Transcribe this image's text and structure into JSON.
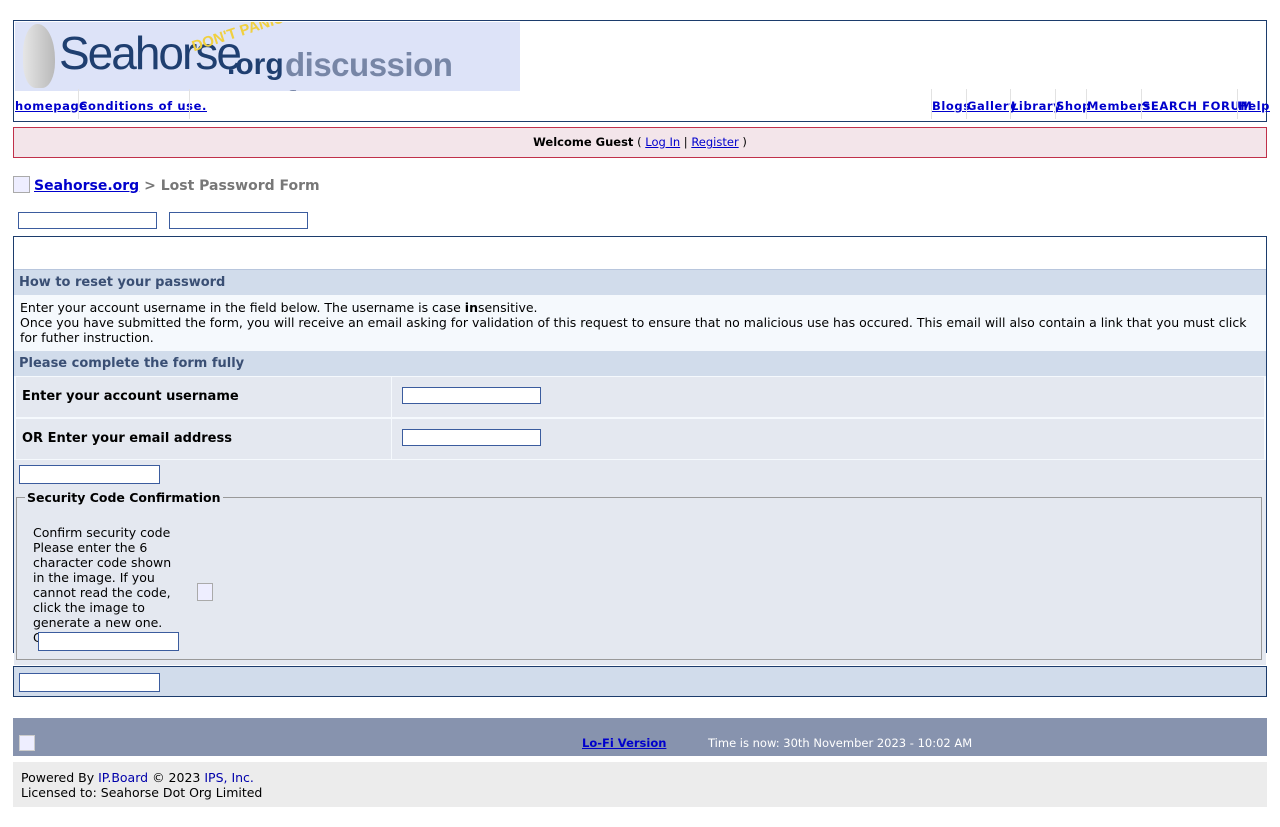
{
  "header": {
    "logo": {
      "site": "Seahorse",
      "tagline": "DON'T PANIC!",
      "tld": ".org",
      "subtitle": "discussion forums"
    },
    "nav_left": [
      "homepage",
      "Conditions of use."
    ],
    "nav_right": [
      "Blogs",
      "Gallery",
      "Library",
      "Shop",
      "Members",
      "SEARCH FORUM",
      "Help"
    ]
  },
  "userbar": {
    "welcome": "Welcome Guest",
    "open": "(",
    "login": "Log In",
    "sep": "|",
    "register": "Register",
    "close": ")"
  },
  "breadcrumb": {
    "home": "Seahorse.org",
    "sep": ">",
    "current": "Lost Password Form"
  },
  "form": {
    "section_title": "How to reset your password",
    "desc_line1_a": "Enter your account username in the field below. The username is case ",
    "desc_line1_bold": "in",
    "desc_line1_b": "sensitive.",
    "desc_line2": "Once you have submitted the form, you will receive an email asking for validation of this request to ensure that no malicious use has occured. This email will also contain a link that you must click for futher instruction.",
    "complete_title": "Please complete the form fully",
    "username_label": "Enter your account username",
    "email_label": "OR Enter your email address",
    "username_value": "",
    "email_value": "",
    "captcha": {
      "legend": "Security Code Confirmation",
      "title": "Confirm security code",
      "help": "Please enter the 6 character code shown in the image. If you cannot read the code, click the image to generate a new one. Case sensitive.",
      "value": ""
    }
  },
  "footer": {
    "lofi": "Lo-Fi Version",
    "time": "Time is now: 30th November 2023 - 10:02 AM",
    "powered_by": "Powered By",
    "ipboard": "IP.Board",
    "copyright": "© 2023",
    "ips": "IPS, Inc.",
    "licensed": "Licensed to: Seahorse Dot Org Limited"
  },
  "colors": {
    "border": "#1c3c6c",
    "bar": "#d1dceb",
    "link": "#0000cc",
    "footer": "#8793ae"
  }
}
